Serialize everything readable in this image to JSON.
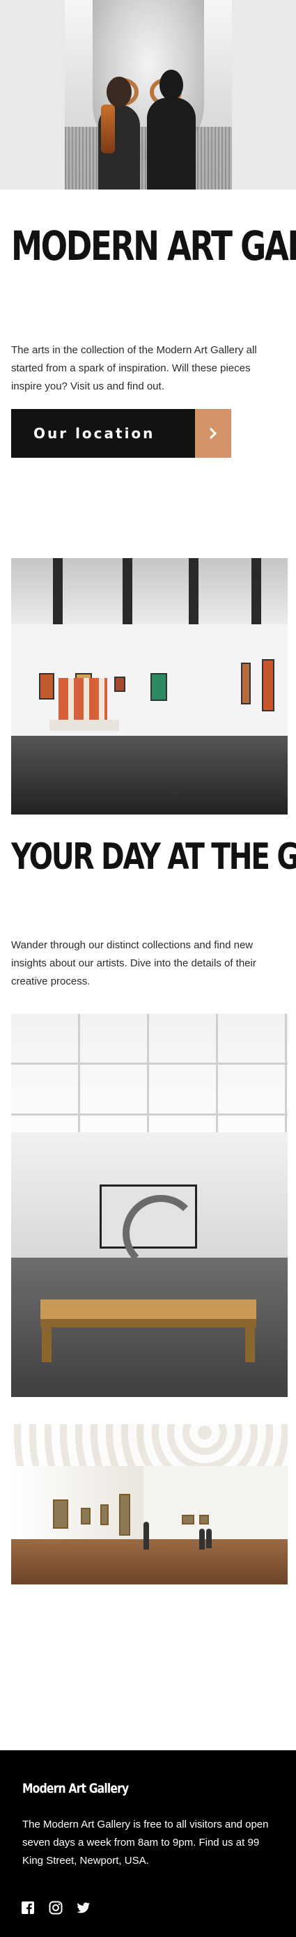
{
  "hero": {
    "title": "Modern Art Gallery",
    "intro": "The arts in the collection of the Modern Art Gallery all started from a spark of inspiration. Will these pieces inspire you? Visit us and find out.",
    "location_button": "Our location",
    "location_icon": "chevron-right-icon"
  },
  "day": {
    "title": "Your Day at the Gallery",
    "text": "Wander through our distinct collections and find new insights about our artists. Dive into the details of their creative process."
  },
  "footer": {
    "logo": "Modern Art Gallery",
    "info": "The Modern Art Gallery is free to all visitors and open seven days a week from 8am to 9pm. Find us at 99 King Street, Newport, USA.",
    "socials": [
      "facebook-icon",
      "instagram-icon",
      "twitter-icon"
    ]
  },
  "colors": {
    "accent": "#d5936a",
    "dark": "#121212",
    "footer_bg": "#000000"
  }
}
